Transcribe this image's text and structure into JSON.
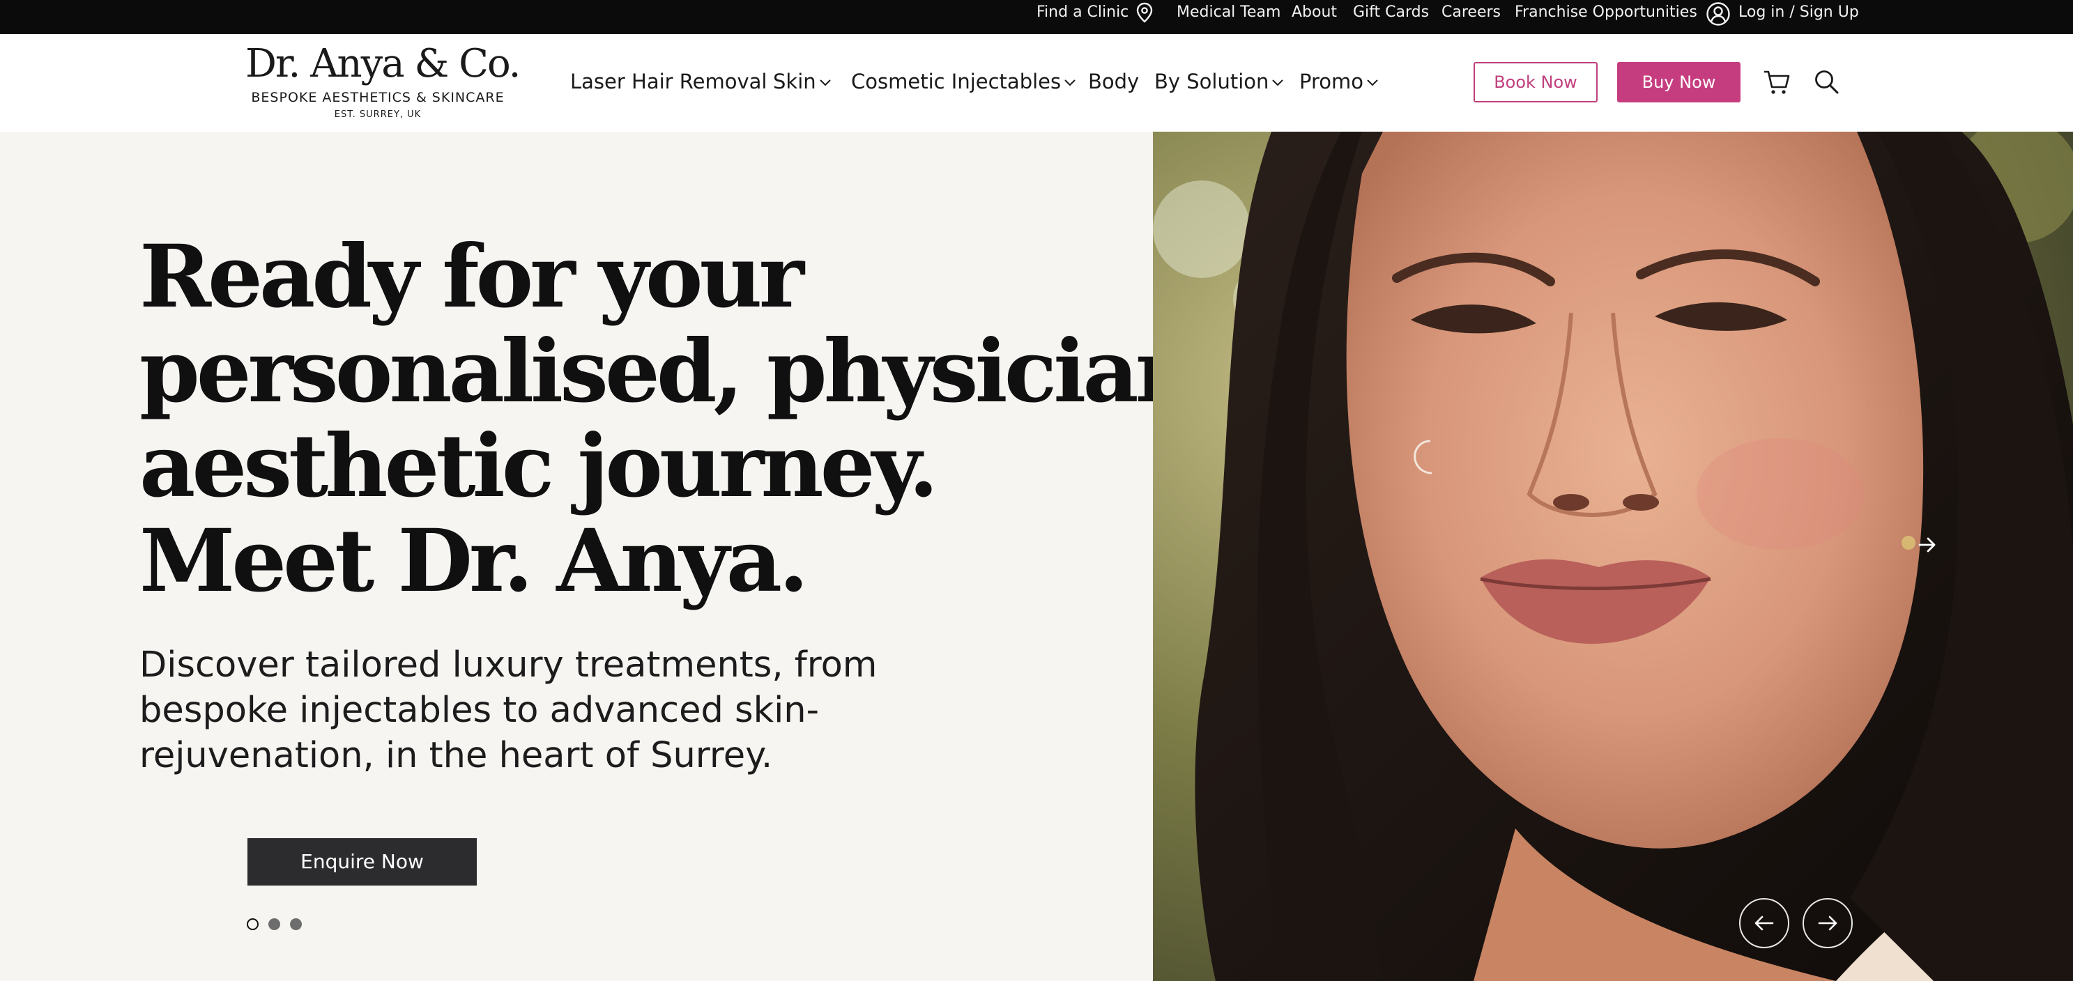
{
  "utility_bar": {
    "find_clinic": "Find a Clinic",
    "medical_team": "Medical Team",
    "about": "About",
    "gift_cards": "Gift Cards",
    "careers": "Careers",
    "franchise": "Franchise Opportunities",
    "login": "Log in / Sign Up"
  },
  "logo": {
    "name": "Dr. Anya & Co.",
    "tagline": "BESPOKE AESTHETICS & SKINCARE",
    "est": "EST. SURREY, UK"
  },
  "nav": {
    "items": [
      {
        "label": "Laser Hair Removal",
        "dropdown": false
      },
      {
        "label": "Skin",
        "dropdown": true
      },
      {
        "label": "Cosmetic Injectables",
        "dropdown": true
      },
      {
        "label": "Body",
        "dropdown": false
      },
      {
        "label": "By Solution",
        "dropdown": true
      },
      {
        "label": "Promo",
        "dropdown": true
      }
    ]
  },
  "header_actions": {
    "book_now": "Book Now",
    "buy_now": "Buy Now",
    "cart_icon": "cart-icon",
    "search_icon": "search-icon"
  },
  "hero": {
    "title_lines": [
      "Ready for your",
      "personalised, physician-led",
      "aesthetic journey.",
      "Meet Dr. Anya."
    ],
    "subtitle": "Discover tailored luxury treatments, from bespoke injectables to advanced skin-rejuvenation, in the heart of Surrey.",
    "cta": "Enquire Now",
    "slides": {
      "count": 3,
      "active": 1
    }
  },
  "colors": {
    "accent": "#c63d7f",
    "utility_bg": "#0b0b0b",
    "hero_bg": "#f6f5f2",
    "cta_bg": "#2c2c2e"
  }
}
